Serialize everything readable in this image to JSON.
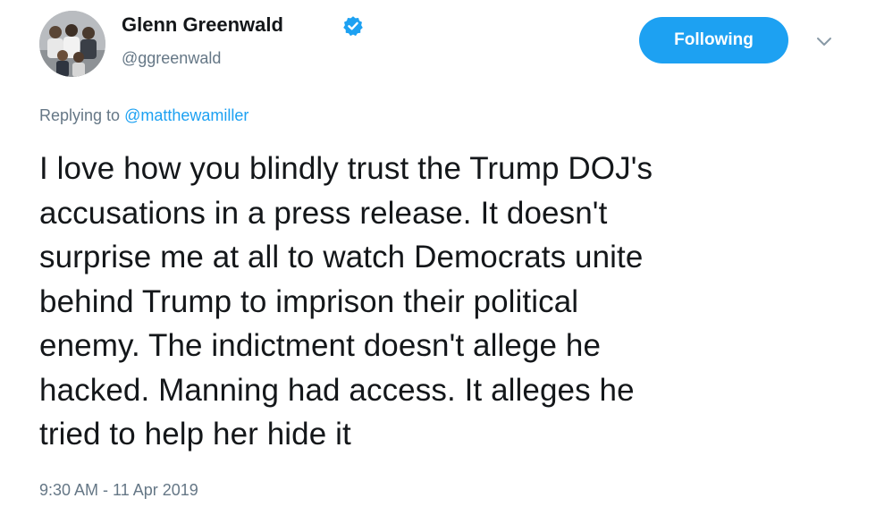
{
  "author": {
    "display_name": "Glenn Greenwald",
    "handle": "@ggreenwald",
    "verified": true
  },
  "follow_button": {
    "label": "Following"
  },
  "menu_caret_icon": "chevron-down-icon",
  "reply": {
    "prefix": "Replying to ",
    "mention": "@matthewamiller"
  },
  "tweet": {
    "lines": [
      "I love how you blindly trust the Trump DOJ's",
      "accusations in a press release. It doesn't",
      "surprise me at all to watch Democrats unite",
      "behind Trump to imprison their political",
      "enemy. The indictment doesn't allege he",
      "hacked. Manning had access. It alleges he",
      "tried to help her hide it"
    ]
  },
  "timestamp": "9:30 AM - 11 Apr 2019",
  "colors": {
    "accent": "#1da1f2",
    "text": "#14171a",
    "secondary_text": "#657786"
  }
}
